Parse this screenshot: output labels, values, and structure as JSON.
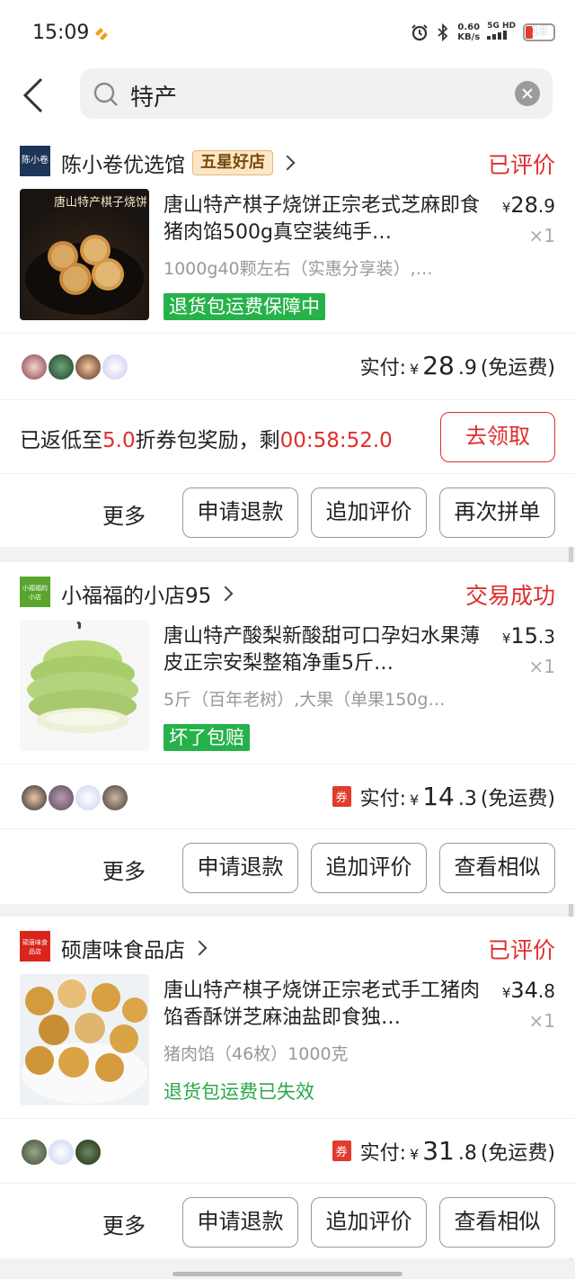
{
  "status_bar": {
    "time": "15:09",
    "speed": "0.60",
    "speed_unit": "KB/s",
    "network": "5G HD",
    "battery": "18"
  },
  "search": {
    "query": "特产"
  },
  "orders": [
    {
      "shop_logo_text": "陈小卷",
      "shop_name": "陈小卷优选馆",
      "shop_badge": "五星好店",
      "status": "已评价",
      "title": "唐山特产棋子烧饼正宗老式芝麻即食猪肉馅500g真空装纯手…",
      "image_caption": "唐山特产棋子烧饼",
      "spec": "1000g40颗左右（实惠分享装）,…",
      "tag": "退货包运费保障中",
      "price_yen": "¥",
      "price_int": "28",
      "price_dec": ".9",
      "qty": "×1",
      "paid_label": "实付:",
      "paid_yen": "¥",
      "paid_int": "28",
      "paid_dec": ".9",
      "shipping": "(免运费)",
      "promo_prefix": "已返低至",
      "promo_discount": "5.0",
      "promo_mid": "折券包奖励，剩",
      "promo_timer": "00:58:52.0",
      "claim_label": "去领取",
      "actions": [
        "更多",
        "申请退款",
        "追加评价",
        "再次拼单"
      ]
    },
    {
      "shop_logo_text": "小福福的小店",
      "shop_name": "小福福的小店95",
      "status": "交易成功",
      "title": "唐山特产酸梨新酸甜可口孕妇水果薄皮正宗安梨整箱净重5斤…",
      "spec": "5斤（百年老树）,大果（单果150g…",
      "tag": "坏了包赔",
      "price_yen": "¥",
      "price_int": "15",
      "price_dec": ".3",
      "qty": "×1",
      "coupon": "券",
      "paid_label": "实付:",
      "paid_yen": "¥",
      "paid_int": "14",
      "paid_dec": ".3",
      "shipping": "(免运费)",
      "actions": [
        "更多",
        "申请退款",
        "追加评价",
        "查看相似"
      ]
    },
    {
      "shop_logo_text": "硕唐味食品店",
      "shop_name": "硕唐味食品店",
      "status": "已评价",
      "title": "唐山特产棋子烧饼正宗老式手工猪肉馅香酥饼芝麻油盐即食独…",
      "spec": "猪肉馅（46枚）1000克",
      "tag": "退货包运费已失效",
      "price_yen": "¥",
      "price_int": "34",
      "price_dec": ".8",
      "qty": "×1",
      "coupon": "券",
      "paid_label": "实付:",
      "paid_yen": "¥",
      "paid_int": "31",
      "paid_dec": ".8",
      "shipping": "(免运费)",
      "actions": [
        "更多",
        "申请退款",
        "追加评价",
        "查看相似"
      ]
    }
  ],
  "colors": {
    "accent_red": "#e02d2d",
    "tag_green": "#26b24a"
  }
}
